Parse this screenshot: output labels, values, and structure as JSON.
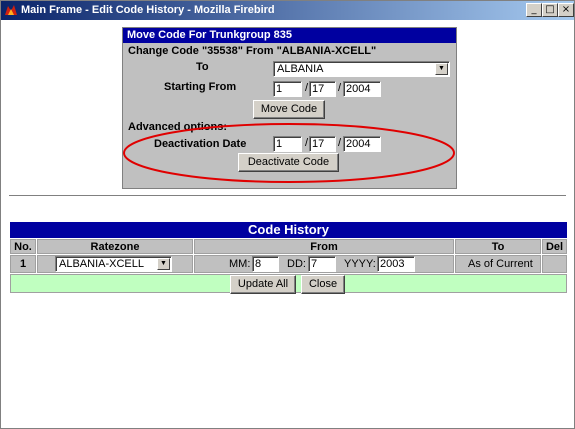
{
  "window": {
    "title": "Main Frame - Edit Code History - Mozilla Firebird",
    "controls": {
      "minimize": "_",
      "maximize": "□",
      "close": "×"
    }
  },
  "move_panel": {
    "header": "Move Code For Trunkgroup 835",
    "change_text": "Change Code \"35538\" From \"ALBANIA-XCELL\"",
    "to_label": "To",
    "to_value": "ALBANIA",
    "starting_from_label": "Starting From",
    "start_month": "1",
    "start_day": "17",
    "start_year": "2004",
    "slash": "/",
    "move_button": "Move Code",
    "advanced_label": "Advanced options:",
    "deactivation_label": "Deactivation Date",
    "deact_month": "1",
    "deact_day": "17",
    "deact_year": "2004",
    "deactivate_button": "Deactivate Code",
    "highlight_color": "#e00000"
  },
  "history": {
    "title": "Code History",
    "headers": {
      "no": "No.",
      "ratezone": "Ratezone",
      "from": "From",
      "to": "To",
      "del": "Del"
    },
    "rows": [
      {
        "no": "1",
        "ratezone": "ALBANIA-XCELL",
        "mm_label": "MM:",
        "mm": "8",
        "dd_label": "DD:",
        "dd": "7",
        "yyyy_label": "YYYY:",
        "yyyy": "2003",
        "to": "As of Current"
      }
    ],
    "update_button": "Update All",
    "close_button": "Close"
  },
  "colors": {
    "header_blue": "#0000a0",
    "panel_gray": "#c0c0c0",
    "footer_green": "#c0ffc0"
  }
}
